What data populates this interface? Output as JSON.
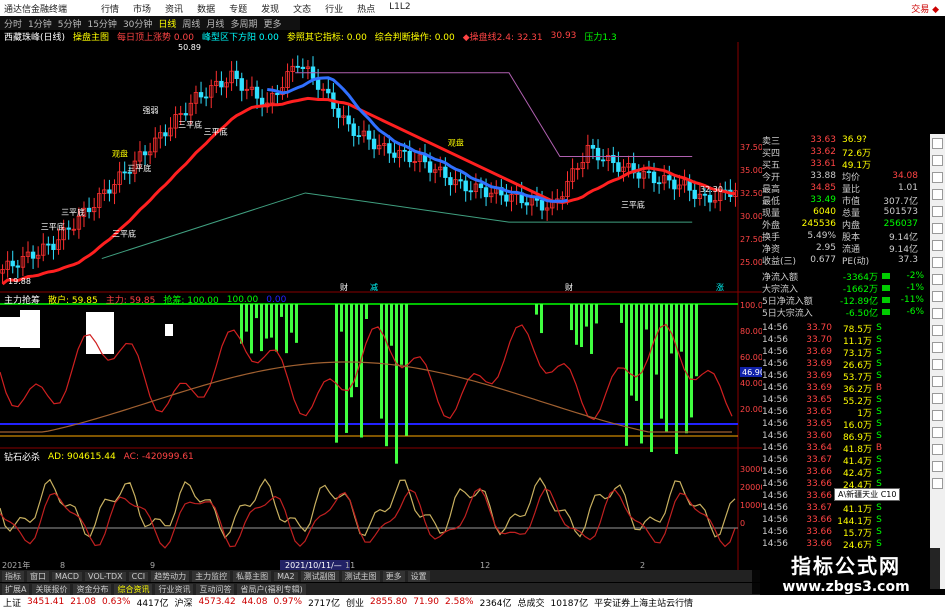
{
  "titlebar": {
    "app_title": "通达信金融终端",
    "menu": [
      "行情",
      "市场",
      "资讯",
      "数据",
      "专题",
      "发现",
      "文态",
      "行业",
      "热点",
      "L1L2"
    ],
    "right": "交易 ◆"
  },
  "periods": [
    "分时",
    "1分钟",
    "5分钟",
    "15分钟",
    "30分钟",
    "日线",
    "周线",
    "月线",
    "多周期",
    "更多"
  ],
  "active_period": "日线",
  "main_panel": {
    "stock_name": "西藏珠峰(日线)",
    "indicator": "操盘主图",
    "items": [
      "每日顶上涨势 0.00",
      "峰型区下方阳 0.00",
      "参照其它指标: 0.00",
      "综合判断操作: 0.00",
      "◆操盘线2.4: 32.31",
      "30.93",
      "压力1.3"
    ],
    "high_label": "50.89",
    "low_label": "19.88",
    "y_ticks": [
      "37.50",
      "35.00",
      "32.50",
      "30.00",
      "27.50",
      "25.00"
    ],
    "cur_label": "32.30",
    "annotations": [
      "观盘",
      "强弱",
      "三平底",
      "三平底",
      "三平底",
      "三平底",
      "三平底",
      "三平底",
      "观盘",
      "三平底"
    ],
    "markers": [
      "财",
      "减",
      "财",
      "涨"
    ]
  },
  "panel2": {
    "title": "主力抢筹",
    "items": [
      "散户: 59.85",
      "主力: 59.85",
      "抢筹: 100.00",
      "100.00",
      "0.00"
    ],
    "y_ticks": [
      "100.00",
      "80.00",
      "60.00",
      "40.00",
      "20.00"
    ],
    "cur_label": "46.90"
  },
  "panel3": {
    "title": "钻石必杀",
    "items": [
      "AD: 904615.44",
      "AC: -420999.61"
    ],
    "y_ticks": [
      "30000",
      "20000",
      "10000",
      "0"
    ],
    "tooltip": "A\\新疆天业 C10"
  },
  "date_axis": [
    "2021年",
    "8",
    "9",
    "2021/10/11/—",
    "11",
    "12",
    "2"
  ],
  "bottom_tabs": [
    "指标",
    "窗口",
    "MACD",
    "VOL-TDX",
    "CCI",
    "趋势动力",
    "主力监控",
    "私募主图",
    "MA2",
    "测试副图",
    "测试主图",
    "更多",
    "设置"
  ],
  "bottom_tabs2": [
    "扩展A",
    "关联报价",
    "资金分布",
    "综合资讯",
    "行业资讯",
    "互动问答",
    "省局户(福利专辑)"
  ],
  "quote": {
    "rows": [
      {
        "lab": "卖三",
        "v1": "33.63",
        "v2": "36.9?",
        "lab2": "",
        "v3": ""
      },
      {
        "lab": "买四",
        "v1": "33.62",
        "v2": "72.6万",
        "lab2": "",
        "v3": ""
      },
      {
        "lab": "买五",
        "v1": "33.61",
        "v2": "49.1万",
        "lab2": "",
        "v3": ""
      },
      {
        "lab": "今开",
        "v1": "33.88",
        "v2": "均价",
        "lab2": "",
        "v3": "34.08"
      },
      {
        "lab": "最高",
        "v1": "34.85",
        "v2": "量比",
        "lab2": "",
        "v3": "1.01"
      },
      {
        "lab": "最低",
        "v1": "33.49",
        "v2": "市值",
        "lab2": "",
        "v3": "307.7亿"
      },
      {
        "lab": "现量",
        "v1": "6040",
        "v2": "总量",
        "lab2": "",
        "v3": "501573"
      },
      {
        "lab": "外盘",
        "v1": "245536",
        "v2": "内盘",
        "lab2": "",
        "v3": "256037"
      },
      {
        "lab": "换手",
        "v1": "5.49%",
        "v2": "股本",
        "lab2": "",
        "v3": "9.14亿"
      },
      {
        "lab": "净资",
        "v1": "2.95",
        "v2": "流通",
        "lab2": "",
        "v3": "9.14亿"
      },
      {
        "lab": "收益(三)",
        "v1": "0.677",
        "v2": "PE(动)",
        "lab2": "",
        "v3": "37.3"
      }
    ],
    "flows": [
      {
        "lab": "净流入额",
        "v": "-3364万",
        "pct": "-2%"
      },
      {
        "lab": "大宗流入",
        "v": "-1662万",
        "pct": "-1%"
      },
      {
        "lab": "5日净流入额",
        "v": "-12.89亿",
        "pct": "-11%"
      },
      {
        "lab": "5日大宗流入",
        "v": "-6.50亿",
        "pct": "-6%"
      }
    ],
    "ticks": [
      {
        "t": "14:56",
        "p": "33.70",
        "vol": "78.5万",
        "bs": "S"
      },
      {
        "t": "14:56",
        "p": "33.70",
        "vol": "11.1万",
        "bs": "S"
      },
      {
        "t": "14:56",
        "p": "33.69",
        "vol": "73.1万",
        "bs": "S"
      },
      {
        "t": "14:56",
        "p": "33.69",
        "vol": "26.6万",
        "bs": "S"
      },
      {
        "t": "14:56",
        "p": "33.69",
        "vol": "53.7万",
        "bs": "S"
      },
      {
        "t": "14:56",
        "p": "33.69",
        "vol": "36.2万",
        "bs": "B"
      },
      {
        "t": "14:56",
        "p": "33.65",
        "vol": "55.2万",
        "bs": "S"
      },
      {
        "t": "14:56",
        "p": "33.65",
        "vol": "1万",
        "bs": "S"
      },
      {
        "t": "14:56",
        "p": "33.65",
        "vol": "16.0万",
        "bs": "S"
      },
      {
        "t": "14:56",
        "p": "33.60",
        "vol": "86.9万",
        "bs": "S"
      },
      {
        "t": "14:56",
        "p": "33.64",
        "vol": "41.8万",
        "bs": "B"
      },
      {
        "t": "14:56",
        "p": "33.67",
        "vol": "41.4万",
        "bs": "S"
      },
      {
        "t": "14:56",
        "p": "33.66",
        "vol": "42.4万",
        "bs": "S"
      },
      {
        "t": "14:56",
        "p": "33.66",
        "vol": "24.4万",
        "bs": "S"
      },
      {
        "t": "14:56",
        "p": "33.66",
        "vol": "18.1万",
        "bs": "S"
      },
      {
        "t": "14:56",
        "p": "33.67",
        "vol": "41.1万",
        "bs": "S"
      },
      {
        "t": "14:56",
        "p": "33.66",
        "vol": "144.1万",
        "bs": "S"
      },
      {
        "t": "14:56",
        "p": "33.66",
        "vol": "15.7万",
        "bs": "S"
      },
      {
        "t": "14:56",
        "p": "33.66",
        "vol": "24.6万",
        "bs": "S"
      }
    ]
  },
  "bottombar": {
    "items": [
      {
        "text": "上证",
        "cls": ""
      },
      {
        "text": "3451.41",
        "cls": "up"
      },
      {
        "text": "21.08",
        "cls": "up"
      },
      {
        "text": "0.63%",
        "cls": "up"
      },
      {
        "text": "4417亿",
        "cls": ""
      },
      {
        "text": "沪深",
        "cls": ""
      },
      {
        "text": "4573.42",
        "cls": "up"
      },
      {
        "text": "44.08",
        "cls": "up"
      },
      {
        "text": "0.97%",
        "cls": "up"
      },
      {
        "text": "2717亿",
        "cls": ""
      },
      {
        "text": "创业",
        "cls": ""
      },
      {
        "text": "2855.80",
        "cls": "up"
      },
      {
        "text": "71.90",
        "cls": "up"
      },
      {
        "text": "2.58%",
        "cls": "up"
      },
      {
        "text": "2364亿",
        "cls": ""
      },
      {
        "text": "总成交",
        "cls": ""
      },
      {
        "text": "10187亿",
        "cls": ""
      },
      {
        "text": "平安证券上海主站云行情",
        "cls": ""
      }
    ]
  },
  "watermark": {
    "line1": "指标公式网",
    "line2": "www.zbgs3.com"
  },
  "colors": {
    "up": "#ff3030",
    "down": "#30e0ff",
    "ma_blue": "#3070ff",
    "ma_red": "#ff2020",
    "green_bar": "#40ff40"
  }
}
